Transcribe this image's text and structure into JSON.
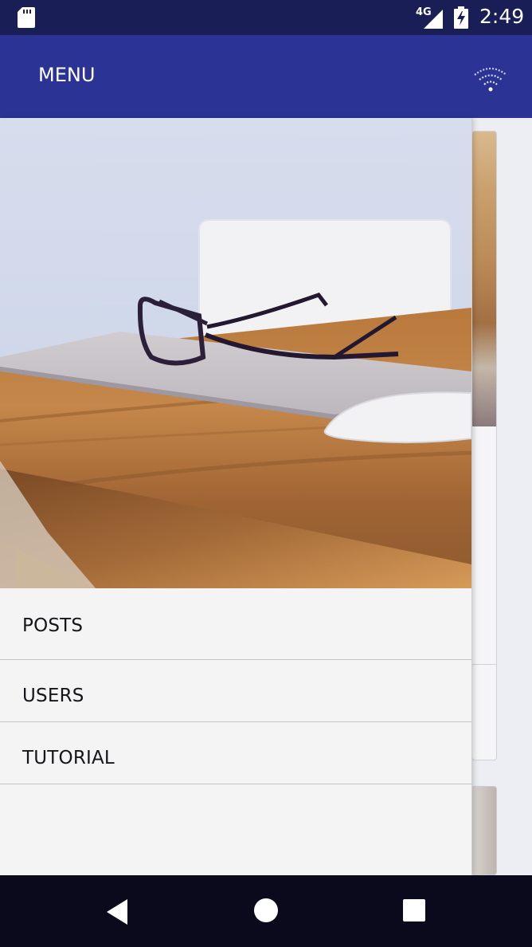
{
  "status_bar": {
    "network": "4G",
    "time": "2:49",
    "icons": [
      "sd-card-icon",
      "signal-icon",
      "battery-charging-icon"
    ]
  },
  "app_bar": {
    "title": "MENU",
    "action_icon": "wifi-icon"
  },
  "drawer": {
    "header_image": "desk-with-glasses-laptop-mouse",
    "items": [
      {
        "label": "POSTS"
      },
      {
        "label": "USERS"
      },
      {
        "label": "TUTORIAL"
      }
    ]
  },
  "nav_bar": {
    "buttons": [
      "back-icon",
      "home-icon",
      "recents-icon"
    ]
  },
  "colors": {
    "status_bar": "#1a1e56",
    "app_bar": "#2b3494",
    "drawer_bg": "#f4f4f5",
    "nav_bar": "#0a0a1c"
  }
}
